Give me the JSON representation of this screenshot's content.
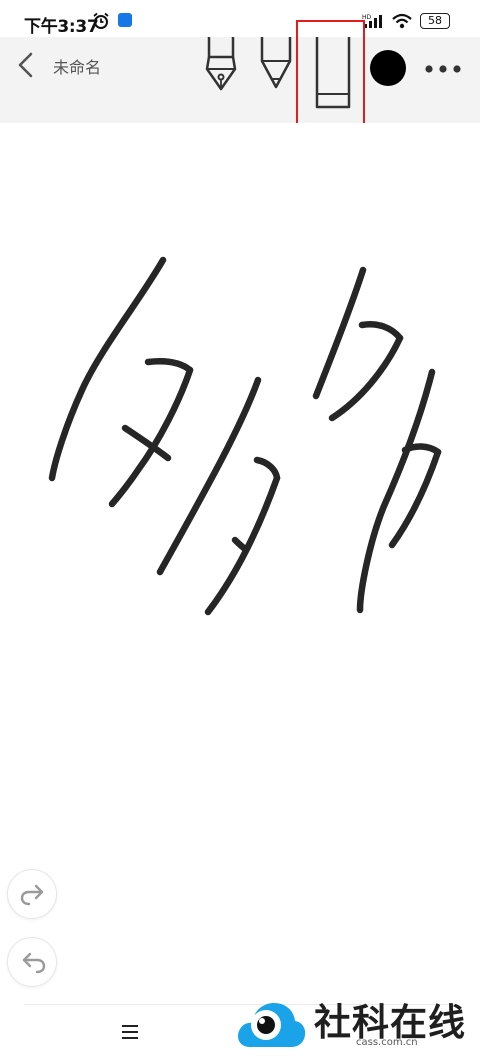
{
  "status_bar": {
    "time": "下午3:37",
    "battery": "58",
    "icons": [
      "alarm-icon",
      "app-notification-icon",
      "hd-icon",
      "signal-icon",
      "wifi-icon",
      "battery-icon"
    ]
  },
  "toolbar": {
    "title": "未命名",
    "tools": [
      "fountain-pen-icon",
      "marker-pen-icon",
      "eraser-icon"
    ],
    "selected_tool": "eraser",
    "pen_color": "#000000",
    "highlight_color": "#e21d1d"
  },
  "canvas": {
    "content": "handwritten strokes"
  },
  "controls": {
    "redo": "redo-icon",
    "undo": "undo-icon",
    "menu": "menu-icon"
  },
  "watermark": {
    "brand": "社科在线",
    "domain": "cass.com.cn",
    "accent_color": "#1aa3e8"
  }
}
